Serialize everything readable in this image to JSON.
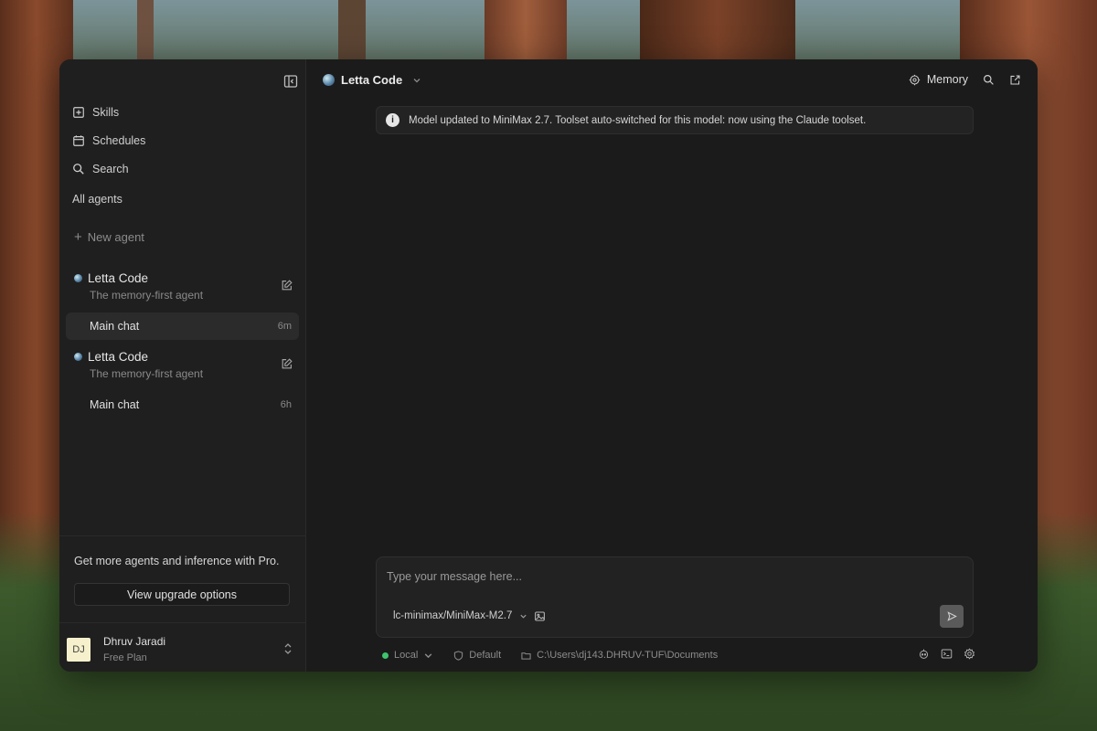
{
  "sidebar": {
    "nav": [
      {
        "label": "Skills",
        "icon": "skills-icon"
      },
      {
        "label": "Schedules",
        "icon": "calendar-icon"
      },
      {
        "label": "Search",
        "icon": "search-icon"
      }
    ],
    "section_label": "All agents",
    "new_agent_label": "New agent",
    "agents": [
      {
        "name": "Letta Code",
        "subtitle": "The memory-first agent",
        "chat": {
          "label": "Main chat",
          "time": "6m",
          "active": true
        }
      },
      {
        "name": "Letta Code",
        "subtitle": "The memory-first agent",
        "chat": {
          "label": "Main chat",
          "time": "6h",
          "active": false
        }
      }
    ],
    "promo": {
      "text": "Get more agents and inference with Pro.",
      "button_label": "View upgrade options"
    },
    "user": {
      "initials": "DJ",
      "name": "Dhruv Jaradi",
      "plan": "Free Plan"
    }
  },
  "header": {
    "agent_name": "Letta Code",
    "memory_label": "Memory"
  },
  "notice": {
    "text": "Model updated to MiniMax 2.7. Toolset auto-switched for this model: now using the Claude toolset."
  },
  "composer": {
    "placeholder": "Type your message here...",
    "model": "lc-minimax/MiniMax-M2.7"
  },
  "status_bar": {
    "environment": "Local",
    "permission": "Default",
    "path": "C:\\Users\\dj143.DHRUV-TUF\\Documents"
  },
  "colors": {
    "window_bg": "#1b1b1b",
    "sidebar_bg": "#1f1f1f",
    "status_green": "#3ec46d",
    "avatar_bg": "#f6f1cc"
  }
}
